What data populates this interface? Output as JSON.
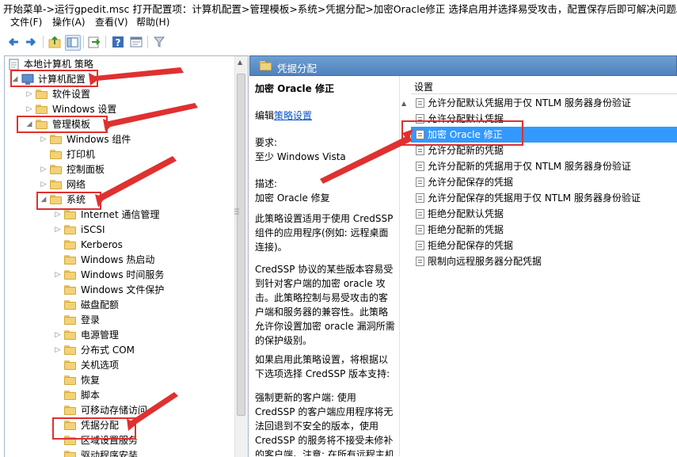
{
  "instruction": "开始菜单->运行gpedit.msc  打开配置项：计算机配置>管理模板>系统>凭据分配>加密Oracle修正 选择启用并选择易受攻击，配置保存后即可解决问题。",
  "menu": [
    "文件(F)",
    "操作(A)",
    "查看(V)",
    "帮助(H)"
  ],
  "toolbar": [
    "back-icon",
    "forward-icon",
    "up-icon",
    "show-hide-tree-icon",
    "export-icon",
    "help-icon",
    "properties-icon",
    "filter-icon"
  ],
  "tree": {
    "root": "本地计算机 策略",
    "items": [
      {
        "label": "计算机配置"
      },
      {
        "label": "软件设置"
      },
      {
        "label": "Windows 设置"
      },
      {
        "label": "管理模板"
      },
      {
        "label": "Windows 组件"
      },
      {
        "label": "打印机"
      },
      {
        "label": "控制面板"
      },
      {
        "label": "网络"
      },
      {
        "label": "系统"
      },
      {
        "label": "Internet 通信管理"
      },
      {
        "label": "iSCSI"
      },
      {
        "label": "Kerberos"
      },
      {
        "label": "Windows 热启动"
      },
      {
        "label": "Windows 时间服务"
      },
      {
        "label": "Windows 文件保护"
      },
      {
        "label": "磁盘配额"
      },
      {
        "label": "登录"
      },
      {
        "label": "电源管理"
      },
      {
        "label": "分布式 COM"
      },
      {
        "label": "关机选项"
      },
      {
        "label": "恢复"
      },
      {
        "label": "脚本"
      },
      {
        "label": "可移动存储访问"
      },
      {
        "label": "凭据分配"
      },
      {
        "label": "区域设置服务"
      },
      {
        "label": "驱动程序安装"
      }
    ]
  },
  "right_header": "凭据分配",
  "description": {
    "title": "加密 Oracle 修正",
    "edit_prefix": "编辑",
    "edit_link": "策略设置",
    "requirement": "要求:\n至少 Windows Vista",
    "desc": "描述:\n加密 Oracle 修复",
    "p1": "此策略设置适用于使用 CredSSP 组件的应用程序(例如: 远程桌面连接)。",
    "p2": "CredSSP 协议的某些版本容易受到针对客户端的加密 oracle 攻击。此策略控制与易受攻击的客户端和服务器的兼容性。此策略允许你设置加密 oracle 漏洞所需的保护级别。",
    "p3": "如果启用此策略设置，将根据以下选项选择 CredSSP 版本支持:",
    "p4": "强制更新的客户端: 使用 CredSSP 的客户端应用程序将无法回退到不安全的版本，使用 CredSSP 的服务将不接受未修补的客户端。注意: 在所有远程主机支持最新版本"
  },
  "settings": {
    "header": "设置",
    "items": [
      "允许分配默认凭据用于仅 NTLM 服务器身份验证",
      "允许分配默认凭据",
      "加密 Oracle 修正",
      "允许分配新的凭据",
      "允许分配新的凭据用于仅 NTLM 服务器身份验证",
      "允许分配保存的凭据",
      "允许分配保存的凭据用于仅 NTLM 服务器身份验证",
      "拒绝分配默认凭据",
      "拒绝分配新的凭据",
      "拒绝分配保存的凭据",
      "限制向远程服务器分配凭据"
    ],
    "selected_index": 2
  },
  "colors": {
    "annotation": "#e03030",
    "selection": "#3399ff",
    "header": "#4f82bd"
  }
}
